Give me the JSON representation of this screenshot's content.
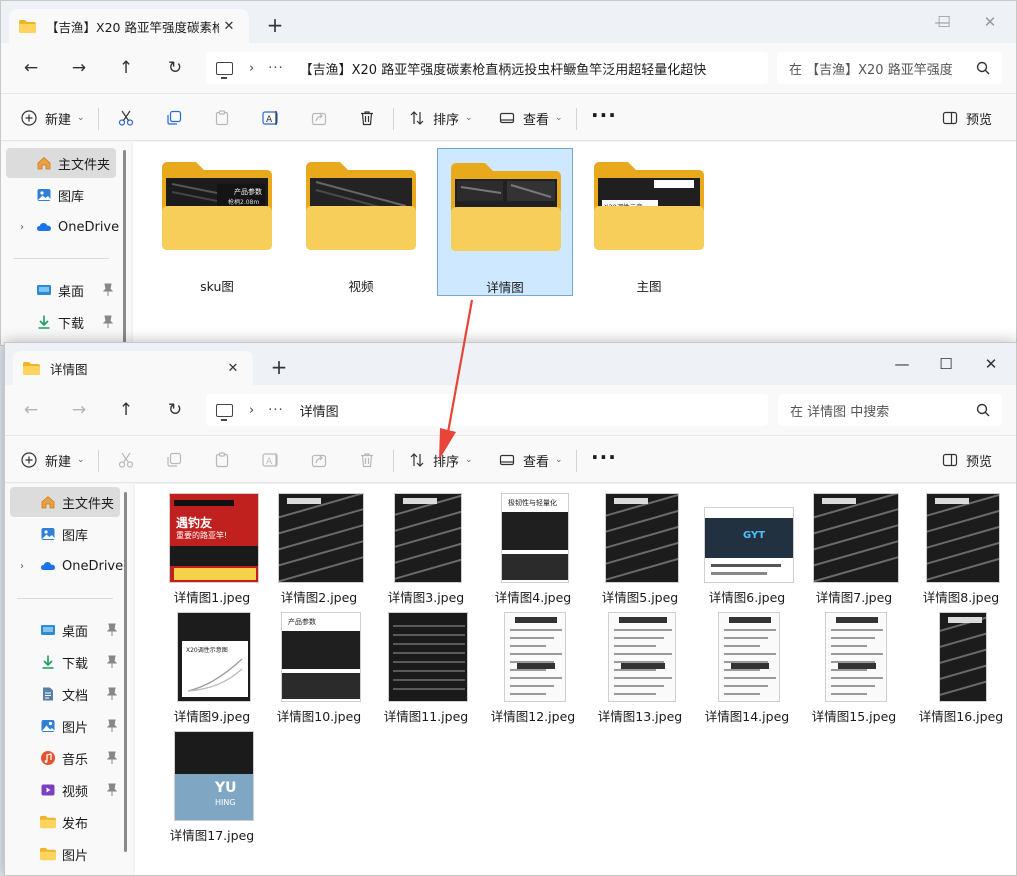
{
  "back_window": {
    "tab_title": "【吉渔】X20 路亚竿强度碳素枪",
    "address_crumb": "【吉渔】X20 路亚竿强度碳素枪直柄远投虫杆鳜鱼竿泛用超轻量化超快",
    "search_placeholder": "在 【吉渔】X20 路亚竿强度",
    "folders": [
      {
        "name": "sku图",
        "thumb_label": "产品参数",
        "thumb_sub": "枪柄2.08m"
      },
      {
        "name": "视频"
      },
      {
        "name": "详情图",
        "selected": true
      },
      {
        "name": "主图",
        "thumb_label": "X20调性示意"
      }
    ],
    "sidebar": [
      {
        "label": "主文件夹",
        "icon": "home-icon",
        "selected": true
      },
      {
        "label": "图库",
        "icon": "gallery-icon"
      },
      {
        "label": "OneDrive",
        "icon": "onedrive-icon"
      },
      {
        "label": "桌面",
        "icon": "desktop-icon"
      },
      {
        "label": "下载",
        "icon": "download-icon"
      }
    ]
  },
  "front_window": {
    "tab_title": "详情图",
    "address_crumb": "详情图",
    "search_placeholder": "在 详情图 中搜索",
    "sidebar": [
      {
        "label": "主文件夹",
        "icon": "home-icon",
        "selected": true
      },
      {
        "label": "图库",
        "icon": "gallery-icon"
      },
      {
        "label": "OneDrive",
        "icon": "onedrive-icon"
      },
      {
        "label": "桌面",
        "icon": "desktop-icon"
      },
      {
        "label": "下载",
        "icon": "download-icon"
      },
      {
        "label": "文档",
        "icon": "documents-icon"
      },
      {
        "label": "图片",
        "icon": "pictures-icon"
      },
      {
        "label": "音乐",
        "icon": "music-icon"
      },
      {
        "label": "视频",
        "icon": "videos-icon"
      },
      {
        "label": "发布",
        "icon": "folder-icon"
      },
      {
        "label": "图片",
        "icon": "folder-icon"
      }
    ],
    "files": [
      "详情图1.jpeg",
      "详情图2.jpeg",
      "详情图3.jpeg",
      "详情图4.jpeg",
      "详情图5.jpeg",
      "详情图6.jpeg",
      "详情图7.jpeg",
      "详情图8.jpeg",
      "详情图9.jpeg",
      "详情图10.jpeg",
      "详情图11.jpeg",
      "详情图12.jpeg",
      "详情图13.jpeg",
      "详情图14.jpeg",
      "详情图15.jpeg",
      "详情图16.jpeg",
      "详情图17.jpeg"
    ],
    "thumb_text": {
      "t1_head": "遇钓友",
      "t1_sub": "重要的路亚竿!",
      "t4_head": "极韧性与轻量化",
      "t6_brand": "GYT",
      "t9_head": "X20调性示意图",
      "t10_head": "产品参数",
      "t17_brand": "YU",
      "t17_sub": "HING"
    }
  },
  "toolbar": {
    "new_label": "新建",
    "sort_label": "排序",
    "view_label": "查看",
    "preview_label": "预览"
  },
  "icons": {
    "cut": "cut-icon",
    "copy": "copy-icon",
    "paste": "paste-icon",
    "rename": "rename-icon",
    "share": "share-icon",
    "delete": "delete-icon",
    "sort": "sort-icon",
    "view": "view-icon",
    "preview": "preview-pane-icon",
    "new": "new-icon"
  },
  "colors": {
    "folder_yellow": "#f5c542",
    "folder_back": "#e8a91d",
    "selection": "#cde8ff",
    "selection_border": "#7aa6d2",
    "arrow_red": "#e8443a"
  }
}
